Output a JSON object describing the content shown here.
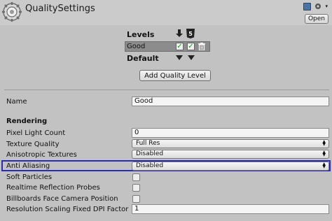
{
  "header": {
    "title": "QualitySettings",
    "open_label": "Open",
    "icons": [
      "gear-icon",
      "book-icon",
      "settings-icon"
    ]
  },
  "levels": {
    "heading": "Levels",
    "rows": [
      {
        "name": "Good",
        "standalone": true,
        "webgl": true
      }
    ],
    "default_label": "Default",
    "add_button": "Add Quality Level",
    "platform_icons": [
      "download-icon",
      "html5-icon"
    ]
  },
  "properties": {
    "name_label": "Name",
    "name_value": "Good",
    "rendering_heading": "Rendering",
    "pixel_light_count_label": "Pixel Light Count",
    "pixel_light_count_value": "0",
    "texture_quality_label": "Texture Quality",
    "texture_quality_value": "Full Res",
    "anisotropic_label": "Anisotropic Textures",
    "anisotropic_value": "Disabled",
    "anti_aliasing_label": "Anti Aliasing",
    "anti_aliasing_value": "Disabled",
    "soft_particles_label": "Soft Particles",
    "soft_particles_checked": false,
    "realtime_reflection_label": "Realtime Reflection Probes",
    "realtime_reflection_checked": false,
    "billboards_label": "Billboards Face Camera Position",
    "billboards_checked": false,
    "resolution_scaling_label": "Resolution Scaling Fixed DPI Factor",
    "resolution_scaling_value": "1"
  },
  "colors": {
    "background": "#c2c2c2",
    "selected_row": "#8c8c8c",
    "highlight_border": "#2b2bb8",
    "check_green": "#1a9a1a"
  }
}
